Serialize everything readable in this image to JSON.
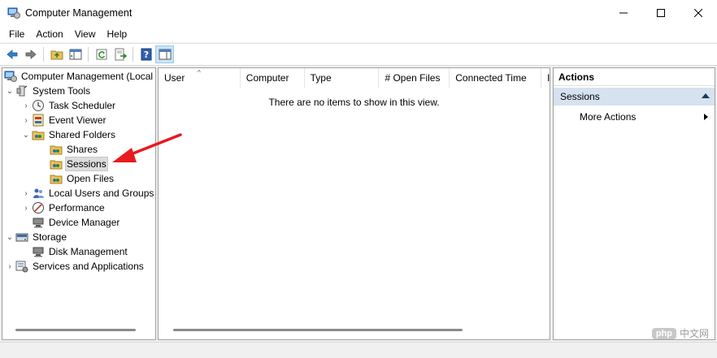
{
  "window": {
    "title": "Computer Management",
    "minimize_glyph": "—",
    "maximize_glyph": "☐",
    "close_glyph": "✕"
  },
  "menu": [
    "File",
    "Action",
    "View",
    "Help"
  ],
  "toolbar": {
    "buttons": [
      "back-icon",
      "forward-icon",
      "up-folder-icon",
      "show-hide-tree-icon",
      "refresh-icon",
      "export-list-icon",
      "help-icon",
      "show-hide-action-pane-icon"
    ]
  },
  "tree": {
    "root": "Computer Management (Local",
    "system_tools": "System Tools",
    "task_scheduler": "Task Scheduler",
    "event_viewer": "Event Viewer",
    "shared_folders": "Shared Folders",
    "shares": "Shares",
    "sessions": "Sessions",
    "open_files": "Open Files",
    "local_users": "Local Users and Groups",
    "performance": "Performance",
    "device_manager": "Device Manager",
    "storage": "Storage",
    "disk_management": "Disk Management",
    "services_apps": "Services and Applications"
  },
  "list": {
    "columns": [
      "User",
      "Computer",
      "Type",
      "# Open Files",
      "Connected Time",
      "I"
    ],
    "empty_message": "There are no items to show in this view."
  },
  "actions": {
    "header": "Actions",
    "section": "Sessions",
    "more_actions": "More Actions"
  },
  "watermark": {
    "badge": "php",
    "text": "中文网"
  },
  "colors": {
    "selection_section": "#d6e2f0",
    "annotation_arrow": "#e8191f"
  }
}
